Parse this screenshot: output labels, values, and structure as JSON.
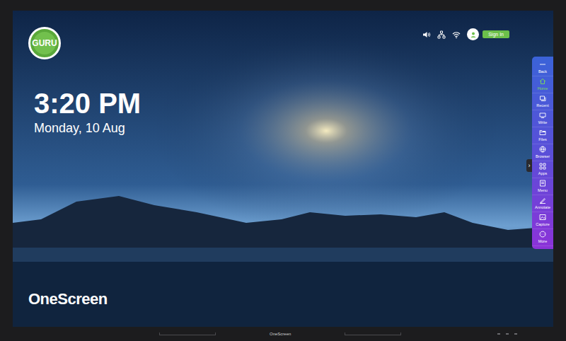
{
  "badge": {
    "text": "GURU"
  },
  "clock": {
    "time": "3:20 PM",
    "date": "Monday, 10 Aug"
  },
  "brand": "OneScreen",
  "status_bar": {
    "sign_in": "Sign In"
  },
  "sidebar": {
    "toggle": "›",
    "items": [
      {
        "label": "Back",
        "selected": false
      },
      {
        "label": "Home",
        "selected": true
      },
      {
        "label": "Recent",
        "selected": false
      },
      {
        "label": "Write",
        "selected": false
      },
      {
        "label": "Files",
        "selected": false
      },
      {
        "label": "Browser",
        "selected": false
      },
      {
        "label": "Apps",
        "selected": false
      },
      {
        "label": "Menu",
        "selected": false
      },
      {
        "label": "Annotate",
        "selected": false
      },
      {
        "label": "Capture",
        "selected": false
      },
      {
        "label": "More",
        "selected": false
      }
    ]
  },
  "bezel": {
    "label": "OneScreen"
  }
}
